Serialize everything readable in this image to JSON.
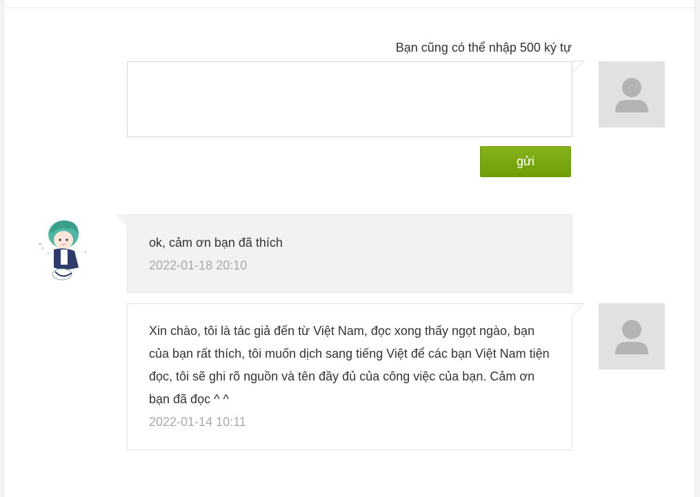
{
  "composer": {
    "hint": "Bạn cũng có thể nhập 500 ký tự",
    "input_value": "",
    "send_label": "gửi"
  },
  "comments": [
    {
      "side": "left",
      "text": "ok, cảm ơn bạn đã thích",
      "time": "2022-01-18 20:10",
      "avatar": "cartoon-boy-avatar"
    },
    {
      "side": "right",
      "text": "Xin chào, tôi là tác giả đến từ Việt Nam, đọc xong thấy ngọt ngào, bạn của bạn rất thích, tôi muốn dịch sang tiếng Việt để các bạn Việt Nam tiện đọc, tôi sẽ ghi rõ nguồn và tên đầy đủ của công việc của bạn. Cảm ơn bạn đã đọc ^ ^",
      "time": "2022-01-14 10:11",
      "avatar": "default-user-icon"
    }
  ],
  "colors": {
    "send_button": "#7aa80f",
    "avatar_bg": "#e1e1e1",
    "avatar_icon": "#b3b3b3",
    "timestamp": "#a9a9a9"
  }
}
